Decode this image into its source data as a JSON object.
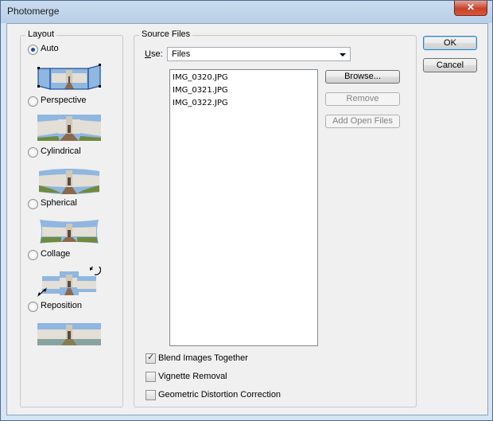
{
  "window": {
    "title": "Photomerge",
    "close_glyph": "✕"
  },
  "layout": {
    "group_label": "Layout",
    "options": [
      {
        "label": "Auto",
        "checked": true
      },
      {
        "label": "Perspective",
        "checked": false
      },
      {
        "label": "Cylindrical",
        "checked": false
      },
      {
        "label": "Spherical",
        "checked": false
      },
      {
        "label": "Collage",
        "checked": false
      },
      {
        "label": "Reposition",
        "checked": false
      }
    ]
  },
  "source_files": {
    "group_label": "Source Files",
    "use_label_underlined": "U",
    "use_label_rest": "se:",
    "use_value": "Files",
    "files": [
      "IMG_0320.JPG",
      "IMG_0321.JPG",
      "IMG_0322.JPG"
    ],
    "browse_label": "Browse...",
    "remove_label": "Remove",
    "add_open_files_label": "Add Open Files",
    "checkbox_blend": {
      "label": "Blend Images Together",
      "checked": true
    },
    "checkbox_vignette": {
      "label": "Vignette Removal",
      "checked": false
    },
    "checkbox_distortion": {
      "label": "Geometric Distortion Correction",
      "checked": false
    }
  },
  "dialog_buttons": {
    "ok_label": "OK",
    "cancel_label": "Cancel"
  },
  "colors": {
    "sky": "#8fb7e0",
    "building": "#e3dfd6",
    "ground": "#8a6a4c",
    "selection_blue": "#1d4f9a"
  }
}
